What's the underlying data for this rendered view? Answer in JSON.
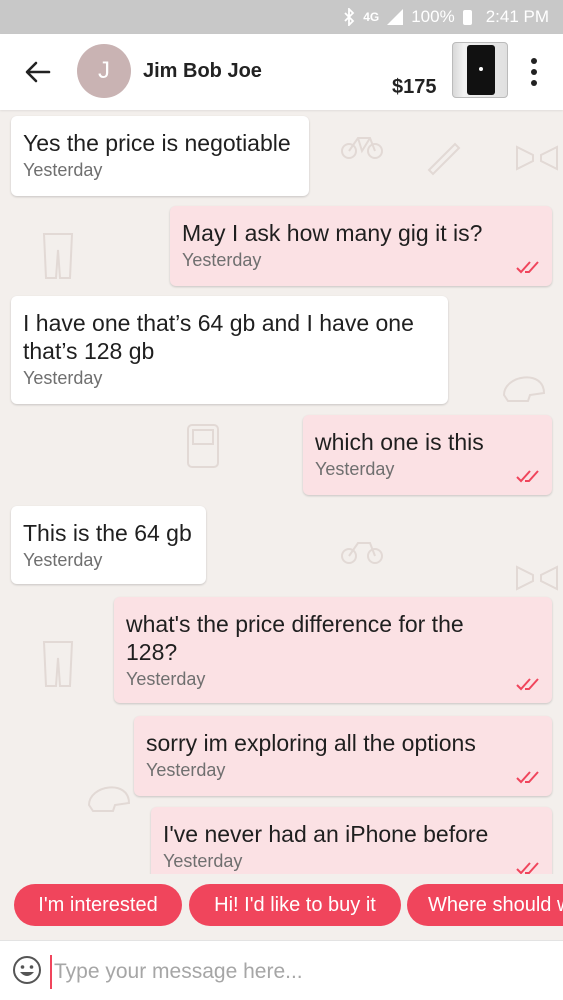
{
  "status_bar": {
    "network": "4G",
    "battery": "100%",
    "time": "2:41 PM"
  },
  "header": {
    "avatar_initial": "J",
    "contact_name": "Jim Bob Joe",
    "price": "$175",
    "product_image": "iphone-thumbnail"
  },
  "messages": [
    {
      "direction": "in",
      "text": "Yes the price is negotiable",
      "time": "Yesterday"
    },
    {
      "direction": "out",
      "text": "May I ask how many gig it is?",
      "time": "Yesterday",
      "read": true
    },
    {
      "direction": "in",
      "text": "I have one that’s 64 gb and I have one that’s 128 gb",
      "time": "Yesterday"
    },
    {
      "direction": "out",
      "text": "which one is this",
      "time": "Yesterday",
      "read": true
    },
    {
      "direction": "in",
      "text": "This is the 64 gb",
      "time": "Yesterday"
    },
    {
      "direction": "out",
      "text": "what's the price difference for the 128?",
      "time": "Yesterday",
      "read": true
    },
    {
      "direction": "out",
      "text": "sorry im exploring all the options",
      "time": "Yesterday",
      "read": true
    },
    {
      "direction": "out",
      "text": "I've never had an iPhone before",
      "time": "Yesterday",
      "read": true
    }
  ],
  "quick_replies": [
    "I'm interested",
    "Hi! I'd like to buy it",
    "Where should we meet?"
  ],
  "input": {
    "placeholder": "Type your message here...",
    "value": ""
  },
  "colors": {
    "accent": "#f0455c",
    "outgoing_bubble": "#fbe1e4",
    "incoming_bubble": "#ffffff",
    "background": "#f3efec",
    "status_bar": "#c8c8c8"
  },
  "icons": [
    "bluetooth-icon",
    "signal-icon",
    "battery-icon",
    "back-arrow-icon",
    "more-options-icon",
    "read-receipt-icon",
    "emoji-icon"
  ]
}
